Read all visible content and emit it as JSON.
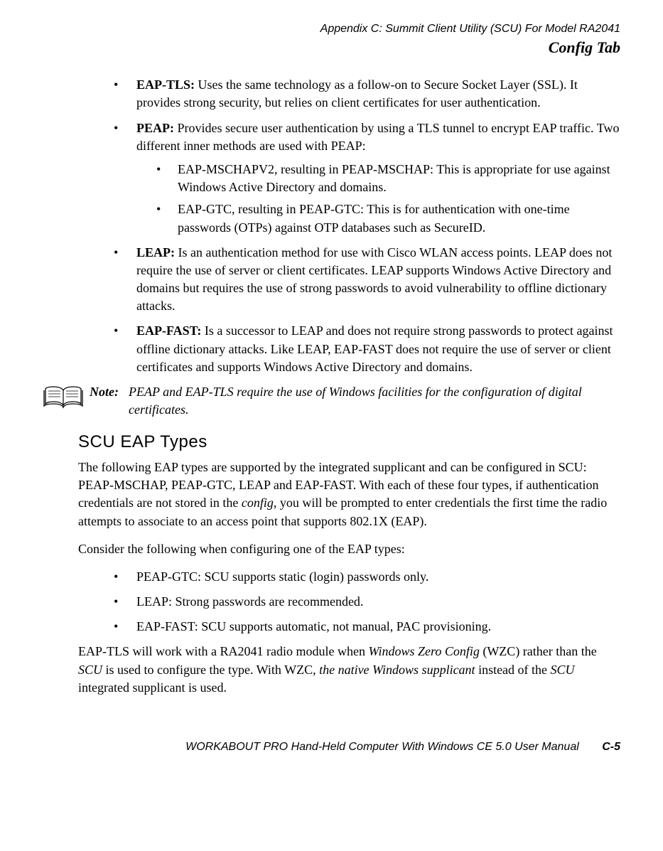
{
  "header": {
    "appendix": "Appendix  C:  Summit Client Utility (SCU) For Model RA2041",
    "section": "Config Tab"
  },
  "bullets": {
    "eaptls": {
      "label": "EAP-TLS: ",
      "text": "Uses the same technology as a follow-on to Secure Socket Layer (SSL). It provides strong security, but relies on client certificates for user authentication."
    },
    "peap": {
      "label": "PEAP: ",
      "text": "Provides secure user authentication by using a TLS tunnel to encrypt EAP traffic. Two different inner methods are used with PEAP:",
      "sub1": "EAP-MSCHAPV2, resulting in PEAP-MSCHAP: This is appropriate for use against Windows Active Directory and domains.",
      "sub2": "EAP-GTC, resulting in PEAP-GTC: This is for authentication with one-time passwords (OTPs) against OTP databases such as SecureID."
    },
    "leap": {
      "label": "LEAP: ",
      "text": "Is an authentication method for use with Cisco WLAN access points. LEAP does not require the use of server or client certificates. LEAP supports Windows Active Directory and domains but requires the use of strong passwords to avoid vulnerability to offline dictionary attacks."
    },
    "eapfast": {
      "label": "EAP-FAST: ",
      "text": "Is a successor to LEAP and does not require strong passwords to protect against offline dictionary attacks. Like LEAP, EAP-FAST does not require the use of server or client certificates and supports Windows Active Directory and domains."
    }
  },
  "note": {
    "label": "Note:",
    "body": "PEAP and EAP-TLS require the use of Windows facilities for the configuration of digital certificates."
  },
  "section": {
    "title": "SCU EAP Types",
    "para1a": "The following EAP types are supported by the integrated supplicant and can be configured in SCU: PEAP-MSCHAP, PEAP-GTC, LEAP and EAP-FAST. With each of these four types, if authentication credentials are not stored in the ",
    "para1_config": "config",
    "para1b": ", you will be prompted to enter credentials the first time the radio attempts to associate to an access point that supports 802.1X (EAP).",
    "para2": "Consider the following when configuring one of the EAP types:",
    "sub1": "PEAP-GTC: SCU supports static (login) passwords only.",
    "sub2": "LEAP: Strong passwords are recommended.",
    "sub3": "EAP-FAST: SCU supports automatic, not manual, PAC provisioning.",
    "para3a": "EAP-TLS will work with a RA2041 radio module when ",
    "para3_i1": "Windows Zero Config",
    "para3b": " (WZC) rather than the ",
    "para3_i2": "SCU",
    "para3c": " is used to configure the type. With WZC, ",
    "para3_i3": "the native Windows supplicant",
    "para3d": " instead of the ",
    "para3_i4": "SCU",
    "para3e": " integrated supplicant is used."
  },
  "footer": {
    "title": "WORKABOUT PRO Hand-Held Computer With Windows CE 5.0 User Manual",
    "page": "C-5"
  }
}
